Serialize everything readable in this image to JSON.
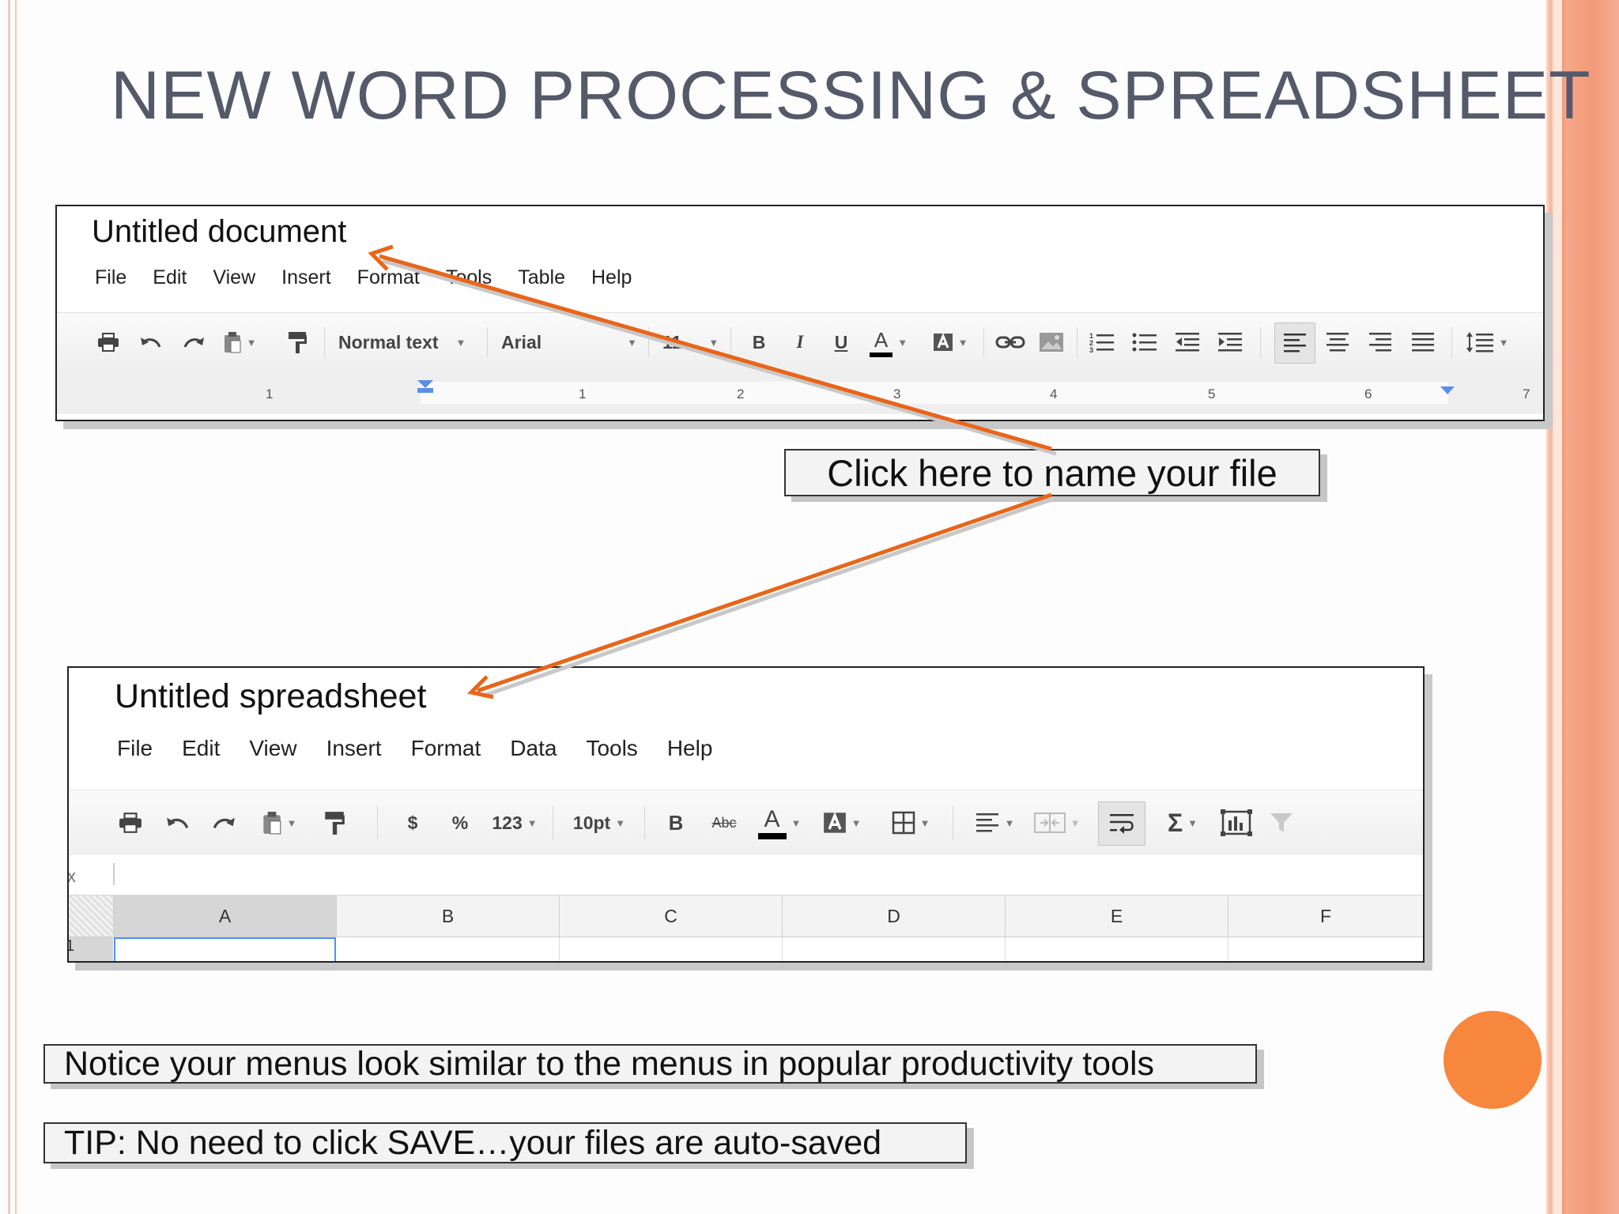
{
  "slide": {
    "title": "NEW WORD PROCESSING & SPREADSHEET",
    "colors": {
      "accent": "#f7873d",
      "arrow": "#e8651a",
      "title": "#555a6a"
    }
  },
  "doc": {
    "title": "Untitled document",
    "menus": [
      "File",
      "Edit",
      "View",
      "Insert",
      "Format",
      "Tools",
      "Table",
      "Help"
    ],
    "toolbar": {
      "icons": [
        "print-icon",
        "undo-icon",
        "redo-icon",
        "paste-icon",
        "paint-format-icon"
      ],
      "style_value": "Normal text",
      "font_value": "Arial",
      "size_value": "11",
      "bold": "B",
      "italic": "I",
      "underline": "U",
      "text_color": "A"
    },
    "ruler_numbers": [
      "1",
      "1",
      "2",
      "3",
      "4",
      "5",
      "6",
      "7"
    ]
  },
  "sheet": {
    "title": "Untitled spreadsheet",
    "menus": [
      "File",
      "Edit",
      "View",
      "Insert",
      "Format",
      "Data",
      "Tools",
      "Help"
    ],
    "toolbar": {
      "currency": "$",
      "percent": "%",
      "number_format": "123",
      "font_size": "10pt",
      "bold": "B",
      "strike": "Abc",
      "text_color": "A",
      "sum": "Σ"
    },
    "columns": [
      "A",
      "B",
      "C",
      "D",
      "E",
      "F"
    ],
    "row_number": "1",
    "formula_prefix": "x"
  },
  "callouts": {
    "name_file": "Click here to name your file",
    "notice": "Notice your menus look similar to the menus in popular productivity tools",
    "tip": "TIP: No need to click SAVE…your files are auto-saved"
  }
}
